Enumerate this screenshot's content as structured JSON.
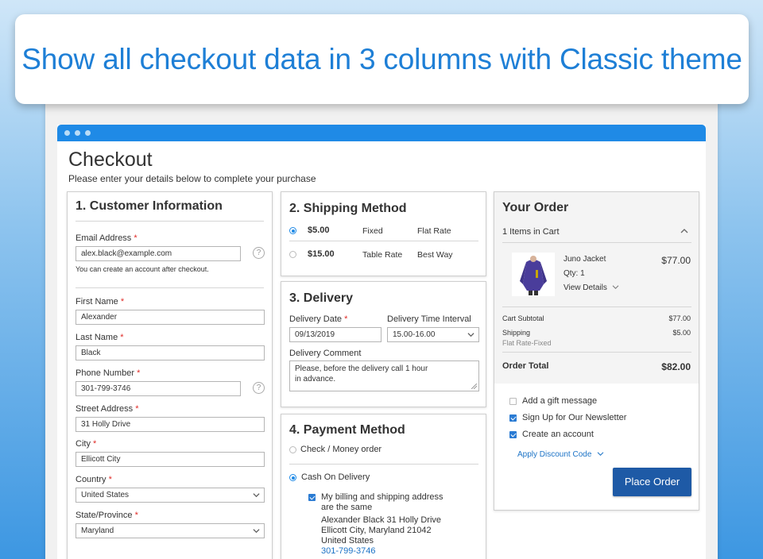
{
  "banner": {
    "text": "Show all checkout data in 3 columns with Classic theme"
  },
  "page": {
    "title": "Checkout",
    "subtitle": "Please enter your details below to complete your purchase"
  },
  "customer": {
    "heading": "1. Customer Information",
    "email_label": "Email Address",
    "email_value": "alex.black@example.com",
    "email_note": "You can create an account after checkout.",
    "first_name_label": "First Name",
    "first_name_value": "Alexander",
    "last_name_label": "Last Name",
    "last_name_value": "Black",
    "phone_label": "Phone Number",
    "phone_value": "301-799-3746",
    "street_label": "Street Address",
    "street_value": "31 Holly Drive",
    "city_label": "City",
    "city_value": "Ellicott City",
    "country_label": "Country",
    "country_value": "United States",
    "state_label": "State/Province",
    "state_value": "Maryland",
    "required_mark": "*",
    "help_mark": "?"
  },
  "shipping": {
    "heading": "2. Shipping Method",
    "options": [
      {
        "price": "$5.00",
        "method": "Fixed",
        "carrier": "Flat Rate",
        "selected": true
      },
      {
        "price": "$15.00",
        "method": "Table Rate",
        "carrier": "Best Way",
        "selected": false
      }
    ]
  },
  "delivery": {
    "heading": "3. Delivery",
    "date_label": "Delivery Date",
    "date_value": "09/13/2019",
    "interval_label": "Delivery Time Interval",
    "interval_value": "15.00-16.00",
    "comment_label": "Delivery Comment",
    "comment_line1": "Please, before the delivery call 1 hour",
    "comment_line2": "in advance."
  },
  "payment": {
    "heading": "4. Payment Method",
    "option1": "Check / Money order",
    "option2": "Cash On Delivery",
    "same_address_line1": "My billing and shipping address",
    "same_address_line2": "are the same",
    "address_line1": "Alexander Black 31 Holly Drive",
    "address_line2": "Ellicott City, Maryland 21042",
    "address_line3": "United States",
    "address_phone": "301-799-3746"
  },
  "order": {
    "heading": "Your Order",
    "items_in_cart": "1 Items in Cart",
    "item_name": "Juno Jacket",
    "item_qty": "Qty:  1",
    "view_details": "View Details",
    "item_price": "$77.00",
    "subtotal_label": "Cart Subtotal",
    "subtotal_value": "$77.00",
    "shipping_label": "Shipping",
    "shipping_sub": "Flat Rate-Fixed",
    "shipping_value": "$5.00",
    "total_label": "Order Total",
    "total_value": "$82.00",
    "gift_label": "Add a gift message",
    "newsletter_label": "Sign Up for Our Newsletter",
    "account_label": "Create an account",
    "discount_label": "Apply Discount Code",
    "place_order": "Place Order"
  },
  "colors": {
    "accent": "#1f8ae6",
    "button": "#1e5aa6",
    "link": "#1c73c6",
    "required": "#e02b27"
  }
}
